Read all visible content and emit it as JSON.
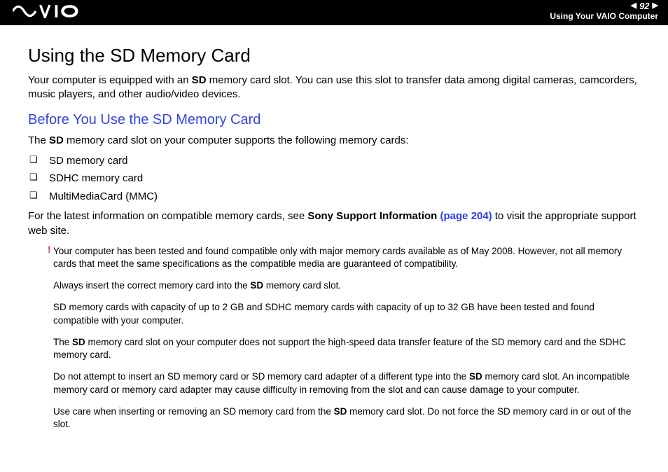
{
  "header": {
    "page_number": "92",
    "breadcrumb": "Using Your VAIO Computer"
  },
  "main": {
    "title": "Using the SD Memory Card",
    "intro_pre": "Your computer is equipped with an ",
    "intro_bold": "SD",
    "intro_post": " memory card slot. You can use this slot to transfer data among digital cameras, camcorders, music players, and other audio/video devices.",
    "subtitle": "Before You Use the SD Memory Card",
    "support_pre": "The ",
    "support_bold": "SD",
    "support_post": " memory card slot on your computer supports the following memory cards:",
    "bullets": [
      "SD memory card",
      "SDHC memory card",
      "MultiMediaCard (MMC)"
    ],
    "latest_pre": "For the latest information on compatible memory cards, see ",
    "latest_link_label": "Sony Support Information",
    "latest_link_page": "(page 204)",
    "latest_post": " to visit the appropriate support web site."
  },
  "warnings": {
    "w1": "Your computer has been tested and found compatible only with major memory cards available as of May 2008. However, not all memory cards that meet the same specifications as the compatible media are guaranteed of compatibility.",
    "w2_pre": "Always insert the correct memory card into the ",
    "w2_bold": "SD",
    "w2_post": " memory card slot.",
    "w3": "SD memory cards with capacity of up to 2 GB and SDHC memory cards with capacity of up to 32 GB have been tested and found compatible with your computer.",
    "w4_pre": "The ",
    "w4_bold": "SD",
    "w4_post": " memory card slot on your computer does not support the high-speed data transfer feature of the SD memory card and the SDHC memory card.",
    "w5_pre": "Do not attempt to insert an SD memory card or SD memory card adapter of a different type into the ",
    "w5_bold": "SD",
    "w5_post": " memory card slot. An incompatible memory card or memory card adapter may cause difficulty in removing from the slot and can cause damage to your computer.",
    "w6_pre": "Use care when inserting or removing an SD memory card from the ",
    "w6_bold": "SD",
    "w6_post": " memory card slot. Do not force the SD memory card in or out of the slot."
  }
}
